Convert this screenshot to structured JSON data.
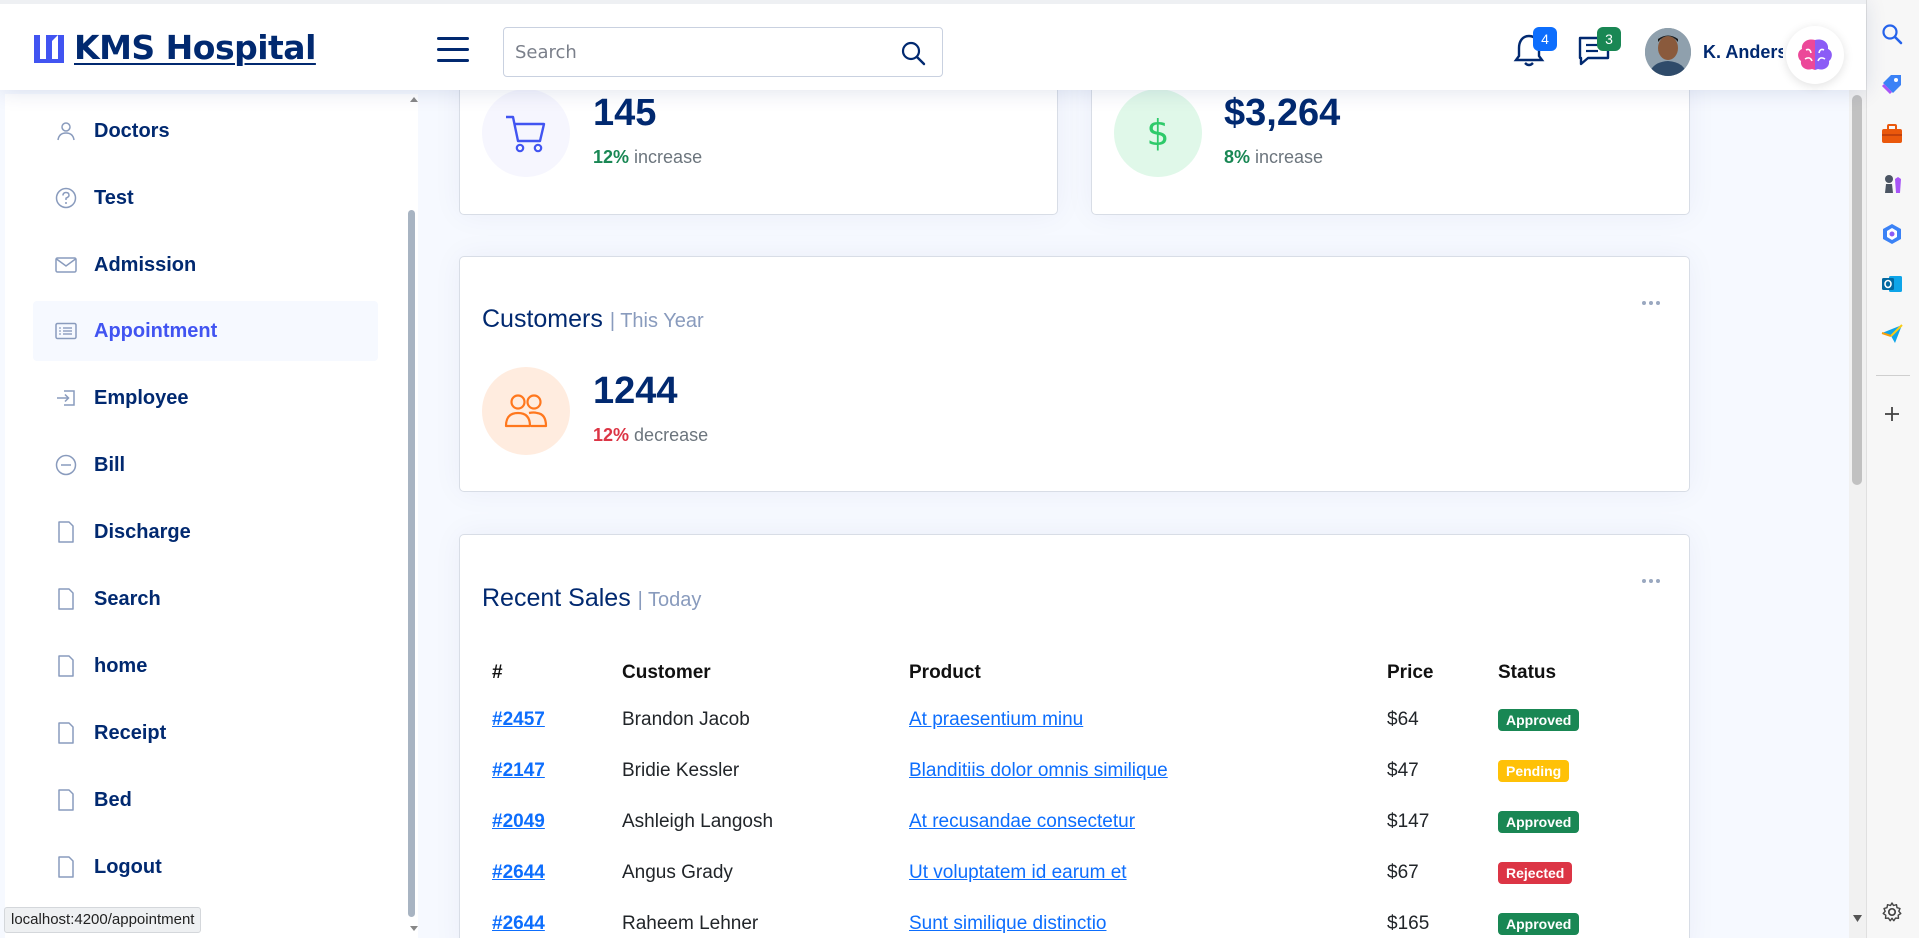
{
  "header": {
    "logo_text": "KMS Hospital",
    "search_placeholder": "Search",
    "notifications_count": "4",
    "messages_count": "3",
    "profile_name": "K. Anderson"
  },
  "sidebar": {
    "items": [
      {
        "label": "Doctors",
        "icon": "person-icon"
      },
      {
        "label": "Test",
        "icon": "question-circle-icon"
      },
      {
        "label": "Admission",
        "icon": "envelope-icon"
      },
      {
        "label": "Appointment",
        "icon": "card-list-icon",
        "active": true
      },
      {
        "label": "Employee",
        "icon": "box-arrow-in-right-icon"
      },
      {
        "label": "Bill",
        "icon": "dash-circle-icon"
      },
      {
        "label": "Discharge",
        "icon": "file-icon"
      },
      {
        "label": "Search",
        "icon": "file-icon"
      },
      {
        "label": "home",
        "icon": "file-icon"
      },
      {
        "label": "Receipt",
        "icon": "file-icon"
      },
      {
        "label": "Bed",
        "icon": "file-icon"
      },
      {
        "label": "Logout",
        "icon": "file-icon"
      }
    ]
  },
  "status_url": "localhost:4200/appointment",
  "sales_card": {
    "value": "145",
    "delta_pct": "12%",
    "delta_label": "increase",
    "color": "#198754"
  },
  "revenue_card": {
    "value": "$3,264",
    "delta_pct": "8%",
    "delta_label": "increase",
    "color": "#198754"
  },
  "customers_card": {
    "title": "Customers",
    "period": "| This Year",
    "value": "1244",
    "delta_pct": "12%",
    "delta_label": "decrease",
    "color": "#dc3545"
  },
  "recent_sales": {
    "title": "Recent Sales",
    "period": "| Today",
    "headers": [
      "#",
      "Customer",
      "Product",
      "Price",
      "Status"
    ],
    "rows": [
      {
        "id": "#2457",
        "customer": "Brandon Jacob",
        "product": "At praesentium minu",
        "price": "$64",
        "status": "Approved",
        "status_color": "#198754"
      },
      {
        "id": "#2147",
        "customer": "Bridie Kessler",
        "product": "Blanditiis dolor omnis similique",
        "price": "$47",
        "status": "Pending",
        "status_color": "#ffc107"
      },
      {
        "id": "#2049",
        "customer": "Ashleigh Langosh",
        "product": "At recusandae consectetur",
        "price": "$147",
        "status": "Approved",
        "status_color": "#198754"
      },
      {
        "id": "#2644",
        "customer": "Angus Grady",
        "product": "Ut voluptatem id earum et",
        "price": "$67",
        "status": "Rejected",
        "status_color": "#dc3545"
      },
      {
        "id": "#2644",
        "customer": "Raheem Lehner",
        "product": "Sunt similique distinctio",
        "price": "$165",
        "status": "Approved",
        "status_color": "#198754"
      }
    ]
  },
  "colors": {
    "brand": "#012970",
    "accent": "#4154f1",
    "success": "#198754",
    "danger": "#dc3545",
    "warning": "#ffc107"
  }
}
